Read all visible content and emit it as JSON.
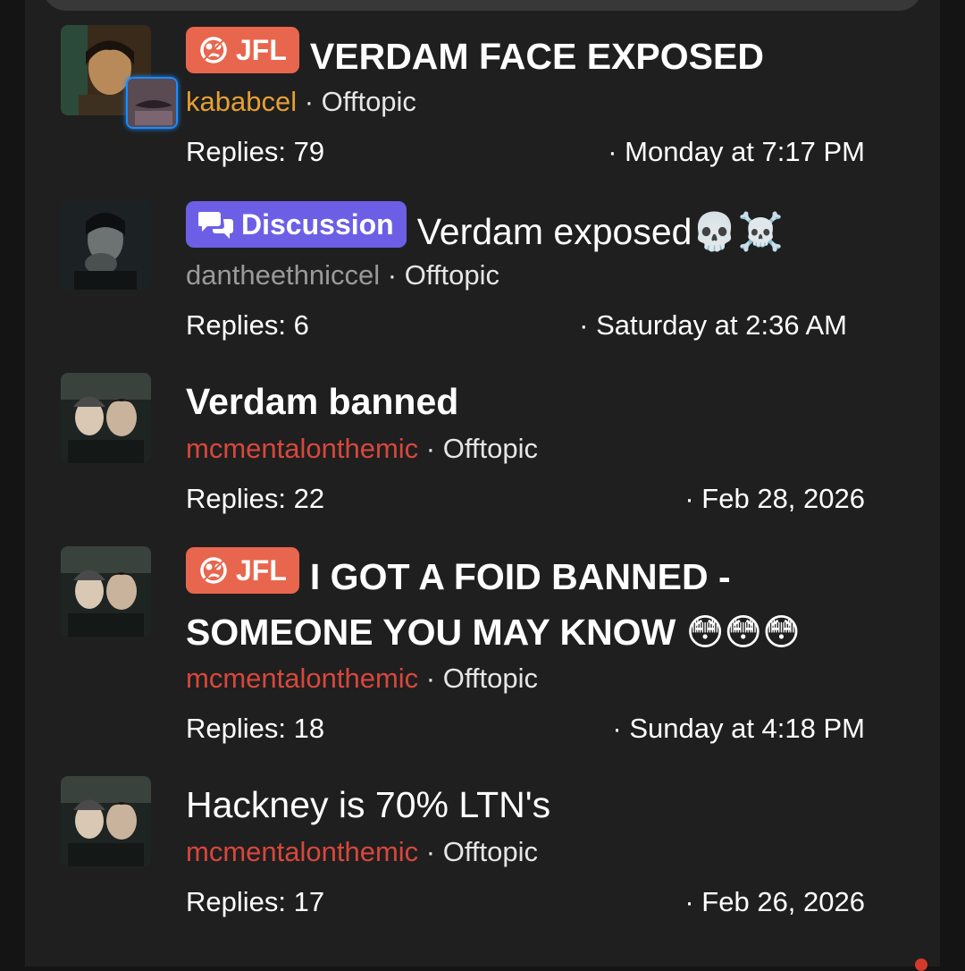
{
  "colors": {
    "jfl_prefix": "#e8664d",
    "discussion_prefix": "#6c5fe6",
    "author_gold": "#e5a034",
    "author_gray": "#9a9a9a",
    "author_red": "#d8473c",
    "background": "#1f1f1f"
  },
  "threads": [
    {
      "prefix": {
        "label": "JFL",
        "icon": "rolling-eyes-icon"
      },
      "title": "VERDAM FACE EXPOSED",
      "author": "kababcel",
      "forum": "Offtopic",
      "replies": "Replies: 79",
      "date": "Monday at 7:17 PM"
    },
    {
      "prefix": {
        "label": "Discussion",
        "icon": "chat-bubbles-icon"
      },
      "title": "Verdam exposed",
      "title_emoji": "💀☠️",
      "author": "dantheethniccel",
      "forum": "Offtopic",
      "replies": "Replies: 6",
      "date": "Saturday at 2:36 AM"
    },
    {
      "title": "Verdam banned",
      "author": "mcmentalonthemic",
      "forum": "Offtopic",
      "replies": "Replies: 22",
      "date": "Feb 28, 2026"
    },
    {
      "prefix": {
        "label": "JFL",
        "icon": "rolling-eyes-icon"
      },
      "title": "I GOT A FOID BANNED -",
      "title_line2": "SOMEONE YOU MAY KNOW",
      "title_emoji": "😳😳😳",
      "author": "mcmentalonthemic",
      "forum": "Offtopic",
      "replies": "Replies: 18",
      "date": "Sunday at 4:18 PM"
    },
    {
      "title": "Hackney is 70% LTN's",
      "author": "mcmentalonthemic",
      "forum": "Offtopic",
      "replies": "Replies: 17",
      "date": "Feb 26, 2026"
    }
  ],
  "separator": "·"
}
